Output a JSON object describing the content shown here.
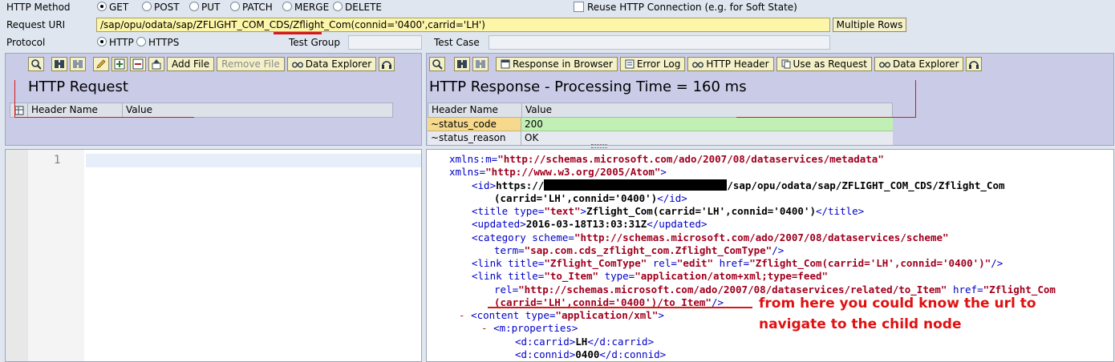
{
  "top": {
    "method_label": "HTTP Method",
    "methods": [
      "GET",
      "POST",
      "PUT",
      "PATCH",
      "MERGE",
      "DELETE"
    ],
    "reuse_label": "Reuse HTTP Connection (e.g. for Soft State)",
    "uri_label": "Request URI",
    "uri_value": "/sap/opu/odata/sap/ZFLIGHT_COM_CDS/Zflight_Com(connid='0400',carrid='LH')",
    "multiple_rows": "Multiple Rows",
    "protocol_label": "Protocol",
    "protocols": [
      "HTTP",
      "HTTPS"
    ],
    "test_group_label": "Test Group",
    "test_case_label": "Test Case"
  },
  "request": {
    "add_file": "Add File",
    "remove_file": "Remove File",
    "data_explorer": "Data Explorer",
    "title": "HTTP Request",
    "col_name": "Header Name",
    "col_value": "Value",
    "line_number": "1"
  },
  "response": {
    "response_in_browser": "Response in Browser",
    "error_log": "Error Log",
    "http_header": "HTTP Header",
    "use_as_request": "Use as Request",
    "data_explorer": "Data Explorer",
    "title": "HTTP Response - Processing Time = 160  ms",
    "col_name": "Header Name",
    "col_value": "Value",
    "rows": [
      {
        "name": "~status_code",
        "value": "200"
      },
      {
        "name": "~status_reason",
        "value": "OK"
      }
    ]
  },
  "xml": {
    "l1_attr": "xmlns:m=",
    "l1_val": "\"http://schemas.microsoft.com/ado/2007/08/dataservices/metadata\"",
    "l2_attr": "xmlns=",
    "l2_val": "\"http://www.w3.org/2005/Atom\"",
    "l2_end": ">",
    "l3_open": "<id>",
    "l3_text_a": "https://",
    "l3_text_b": "/sap/opu/odata/sap/ZFLIGHT_COM_CDS/Zflight_Com",
    "l4_text": "(carrid='LH',connid='0400')",
    "l4_close": "</id>",
    "l5_open": "<title type=",
    "l5_val": "\"text\"",
    "l5_gt": ">",
    "l5_text": "Zflight_Com(carrid='LH',connid='0400')",
    "l5_close": "</title>",
    "l6_open": "<updated>",
    "l6_text": "2016-03-18T13:03:31Z",
    "l6_close": "</updated>",
    "l7_open": "<category scheme=",
    "l7_val": "\"http://schemas.microsoft.com/ado/2007/08/dataservices/scheme\"",
    "l8_attr": "term=",
    "l8_val": "\"sap.com.cds_zflight_com.Zflight_ComType\"",
    "l8_end": "/>",
    "l9_open": "<link title=",
    "l9_v1": "\"Zflight_ComType\"",
    "l9_a2": " rel=",
    "l9_v2": "\"edit\"",
    "l9_a3": " href=",
    "l9_v3": "\"Zflight_Com(carrid='LH',connid='0400')\"",
    "l9_end": "/>",
    "l10_open": "<link title=",
    "l10_v1": "\"to_Item\"",
    "l10_a2": " type=",
    "l10_v2": "\"application/atom+xml;type=feed\"",
    "l11_attr": "rel=",
    "l11_val": "\"http://schemas.microsoft.com/ado/2007/08/dataservices/related/to_Item\"",
    "l11_a2": " href=",
    "l11_v2": "\"Zflight_Com",
    "l12_val": "(carrid='LH',connid='0400')/to_Item\"",
    "l12_end": "/>",
    "l13_dash": "-",
    "l13_open": "<content type=",
    "l13_val": "\"application/xml\"",
    "l13_end": ">",
    "l14_dash": "-",
    "l14_tag": "<m:properties>",
    "l15_open": "<d:carrid>",
    "l15_text": "LH",
    "l15_close": "</d:carrid>",
    "l16_open": "<d:connid>",
    "l16_text": "0400",
    "l16_close": "</d:connid>"
  },
  "annotation": {
    "line1": "from here you could know the url to",
    "line2": "navigate to the child node"
  }
}
